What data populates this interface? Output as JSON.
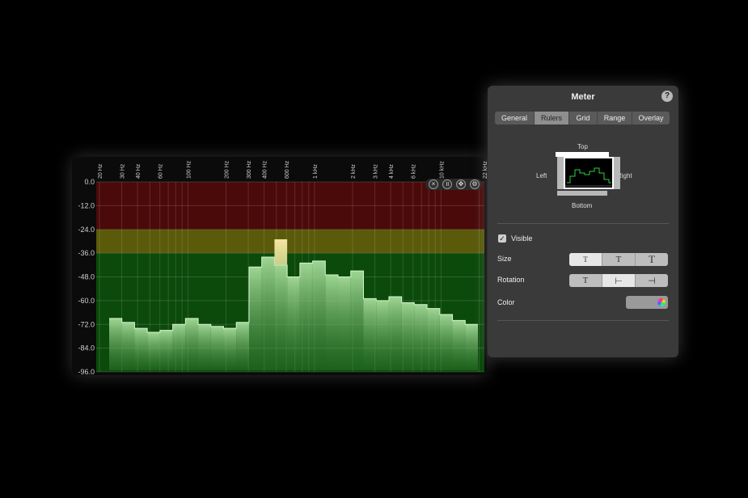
{
  "meter": {
    "freq_labels": [
      {
        "label": "20 Hz",
        "hz": 20
      },
      {
        "label": "30 Hz",
        "hz": 30
      },
      {
        "label": "40 Hz",
        "hz": 40
      },
      {
        "label": "60 Hz",
        "hz": 60
      },
      {
        "label": "100 Hz",
        "hz": 100
      },
      {
        "label": "200 Hz",
        "hz": 200
      },
      {
        "label": "300 Hz",
        "hz": 300
      },
      {
        "label": "400 Hz",
        "hz": 400
      },
      {
        "label": "600 Hz",
        "hz": 600
      },
      {
        "label": "1 kHz",
        "hz": 1000
      },
      {
        "label": "2 kHz",
        "hz": 2000
      },
      {
        "label": "3 kHz",
        "hz": 3000
      },
      {
        "label": "4 kHz",
        "hz": 4000
      },
      {
        "label": "6 kHz",
        "hz": 6000
      },
      {
        "label": "10 kHz",
        "hz": 10000
      },
      {
        "label": "22 kHz",
        "hz": 22000
      }
    ],
    "level_labels": [
      "0.0",
      "-12.0",
      "-24.0",
      "-36.0",
      "-48.0",
      "-60.0",
      "-72.0",
      "-84.0",
      "-96.0"
    ],
    "level_range_db": [
      -96,
      0
    ],
    "zones": [
      {
        "from": -96,
        "to": -36,
        "color": "#0b4a0b"
      },
      {
        "from": -36,
        "to": -24,
        "color": "#5a5a0a"
      },
      {
        "from": -24,
        "to": 0,
        "color": "#4a0a0a"
      }
    ],
    "bars_db": [
      -69,
      -71,
      -74,
      -76,
      -75,
      -72,
      -69,
      -72,
      -73,
      -74,
      -71,
      -43,
      -38,
      -42,
      -48,
      -41,
      -40,
      -47,
      -48,
      -45,
      -59,
      -60,
      -58,
      -61,
      -62,
      -64,
      -67,
      -70,
      -72
    ],
    "peak_bar_db": -29,
    "peak_bar_index": 13,
    "controls": [
      {
        "name": "close-control-button",
        "glyph": "×"
      },
      {
        "name": "pause-control-button",
        "glyph": "॥"
      },
      {
        "name": "move-control-button",
        "glyph": "✥"
      },
      {
        "name": "settings-control-button",
        "glyph": "⚙"
      }
    ]
  },
  "inspector": {
    "title": "Meter",
    "help": "?",
    "tabs": [
      "General",
      "Rulers",
      "Grid",
      "Range",
      "Overlay"
    ],
    "selected_tab": "Rulers",
    "ruler_positions": {
      "top": "Top",
      "left": "Left",
      "right": "Right",
      "bottom": "Bottom"
    },
    "visible_label": "Visible",
    "visible_checked": true,
    "size_label": "Size",
    "size_options": [
      "T",
      "T",
      "T"
    ],
    "size_selected": 0,
    "rotation_label": "Rotation",
    "rotation_options": [
      "T",
      "⊢",
      "⊣"
    ],
    "rotation_selected": 1,
    "color_label": "Color",
    "ruler_color": "#9a9a9a",
    "checkmark": "✓"
  }
}
